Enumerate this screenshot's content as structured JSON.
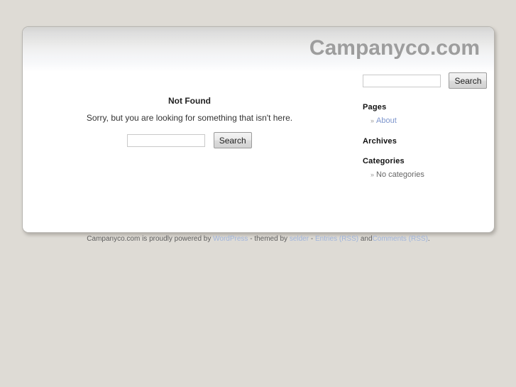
{
  "header": {
    "site_title": "Campanyco.com"
  },
  "content": {
    "heading": "Not Found",
    "message": "Sorry, but you are looking for something that isn't here.",
    "search": {
      "value": "",
      "placeholder": "",
      "button_label": "Search"
    }
  },
  "sidebar": {
    "search": {
      "value": "",
      "placeholder": "",
      "button_label": "Search"
    },
    "widgets": [
      {
        "title": "Pages",
        "items": [
          {
            "bullet": "»",
            "label": "About",
            "is_link": true
          }
        ]
      },
      {
        "title": "Archives",
        "items": []
      },
      {
        "title": "Categories",
        "items": [
          {
            "bullet": "»",
            "label": "No categories",
            "is_link": false
          }
        ]
      }
    ]
  },
  "footer": {
    "part1": "Campanyco.com is proudly powered by",
    "link_wordpress": "WordPress",
    "part2": "- themed by",
    "link_theme": "selder",
    "part3": "-",
    "link_entries": "Entries (RSS)",
    "part4": "and",
    "link_comments": "Comments (RSS)",
    "part5": "."
  },
  "colors": {
    "page_background": "#dedbd5",
    "title_text": "#9d9d9d",
    "link": "#7d95cc",
    "footer_link": "#9fb4dc",
    "container_background": "#ffffff"
  }
}
